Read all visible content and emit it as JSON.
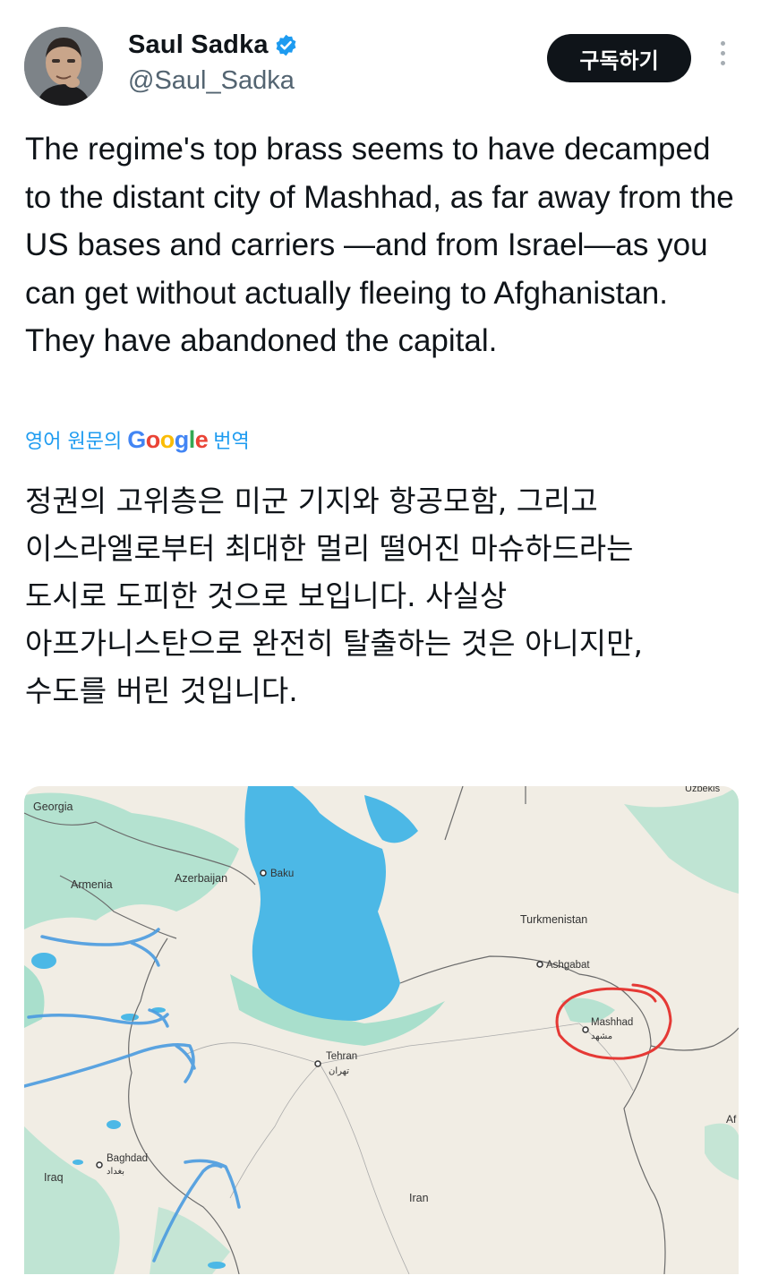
{
  "author": {
    "name": "Saul Sadka",
    "handle": "@Saul_Sadka"
  },
  "actions": {
    "subscribe_label": "구독하기"
  },
  "tweet": {
    "text": "The regime's top brass seems to have decamped to the distant city of Mashhad, as far away from the US bases and carriers —and from Israel—as you can get without actually fleeing to Afghanistan. They have abandoned the capital."
  },
  "translation": {
    "prefix": "영어 원문의",
    "brand": "Google",
    "suffix": "번역",
    "text": "정권의 고위층은 미군 기지와 항공모함, 그리고\n이스라엘로부터 최대한 멀리 떨어진 마슈하드라는\n도시로 도피한 것으로 보입니다. 사실상\n아프가니스탄으로 완전히 탈출하는 것은 아니지만,\n수도를 버린 것입니다."
  },
  "map": {
    "labels": {
      "georgia": "Georgia",
      "armenia": "Armenia",
      "azerbaijan": "Azerbaijan",
      "baku": "Baku",
      "turkmenistan": "Turkmenistan",
      "ashgabat": "Ashgabat",
      "mashhad": "Mashhad",
      "mashhad_local": "مشهد",
      "tehran": "Tehran",
      "tehran_local": "تهران",
      "baghdad": "Baghdad",
      "baghdad_local": "بغداد",
      "iraq": "Iraq",
      "iran": "Iran",
      "uzbekistan_partial": "Uzbekis",
      "afghanistan_partial": "Af"
    },
    "colors": {
      "sea": "#4cb8e6",
      "land": "#f1ede4",
      "vegetation": "#9ed9c4",
      "annotation_circle": "#e53935",
      "annotation_arrows": "#4a9be0"
    }
  }
}
